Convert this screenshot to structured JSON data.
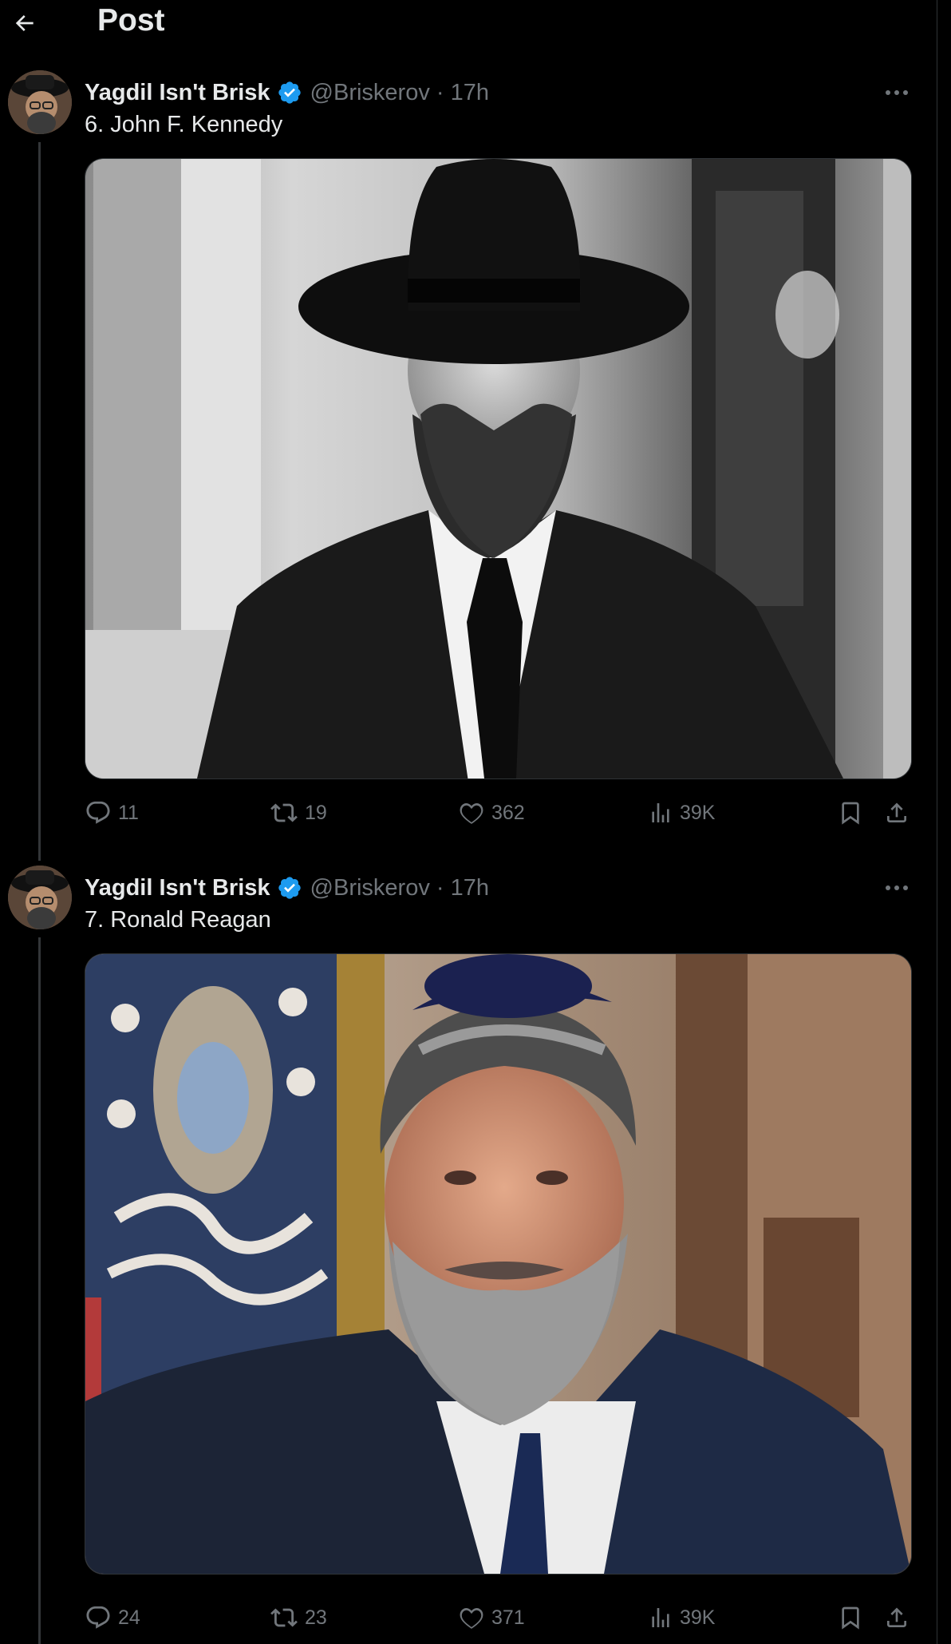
{
  "header": {
    "title": "Post"
  },
  "tweets": [
    {
      "author_name": "Yagdil Isn't Brisk",
      "handle_time": "@Briskerov · 17h",
      "text": "6. John F. Kennedy",
      "media_alt": "Black and white photo of a bearded man in a black hat and suit",
      "replies": "11",
      "reposts": "19",
      "likes": "362",
      "views": "39K"
    },
    {
      "author_name": "Yagdil Isn't Brisk",
      "handle_time": "@Briskerov · 17h",
      "text": "7. Ronald Reagan",
      "media_alt": "Color photo of a bearded man in a kippah and navy suit in front of a flag",
      "replies": "24",
      "reposts": "23",
      "likes": "371",
      "views": "39K"
    }
  ],
  "colors": {
    "background": "#000000",
    "text": "#e7e9ea",
    "muted": "#71767b",
    "verified": "#1d9bf0",
    "divider": "#2f3336"
  },
  "icons": [
    "back-arrow-icon",
    "verified-badge-icon",
    "more-icon",
    "reply-icon",
    "repost-icon",
    "like-icon",
    "views-icon",
    "bookmark-icon",
    "share-icon"
  ]
}
